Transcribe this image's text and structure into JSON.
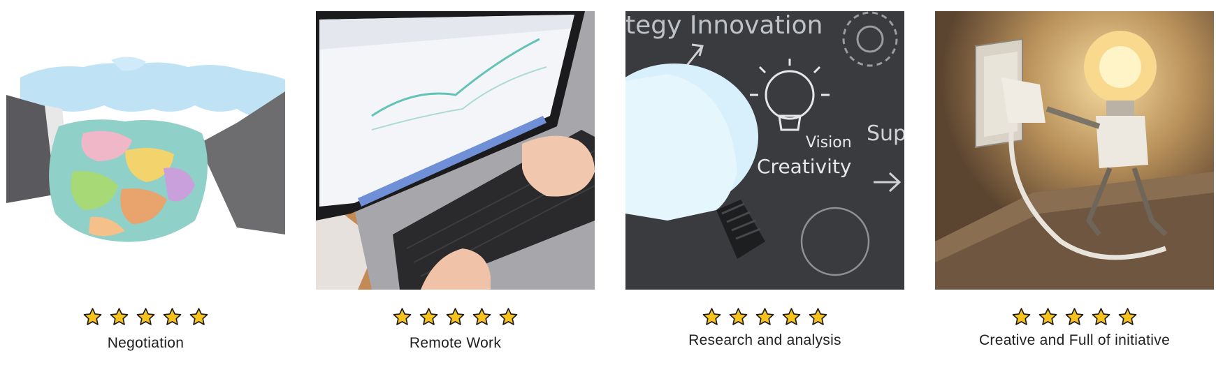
{
  "cards": [
    {
      "label": "Negotiation",
      "rating": 5,
      "image_icon": "world-map-handshake-image"
    },
    {
      "label": "Remote Work",
      "rating": 5,
      "image_icon": "laptop-typing-image"
    },
    {
      "label": "Research and analysis",
      "rating": 5,
      "image_icon": "chalkboard-lightbulb-image",
      "image_text": {
        "top": "tegy Innovation",
        "vision": "Vision",
        "creativity": "Creativity",
        "side": "Sup"
      }
    },
    {
      "label": "Creative and Full of initiative",
      "rating": 5,
      "image_icon": "lightbulb-robot-image"
    }
  ],
  "colors": {
    "star_fill": "#F7C21C",
    "star_stroke": "#1a1a1a"
  }
}
